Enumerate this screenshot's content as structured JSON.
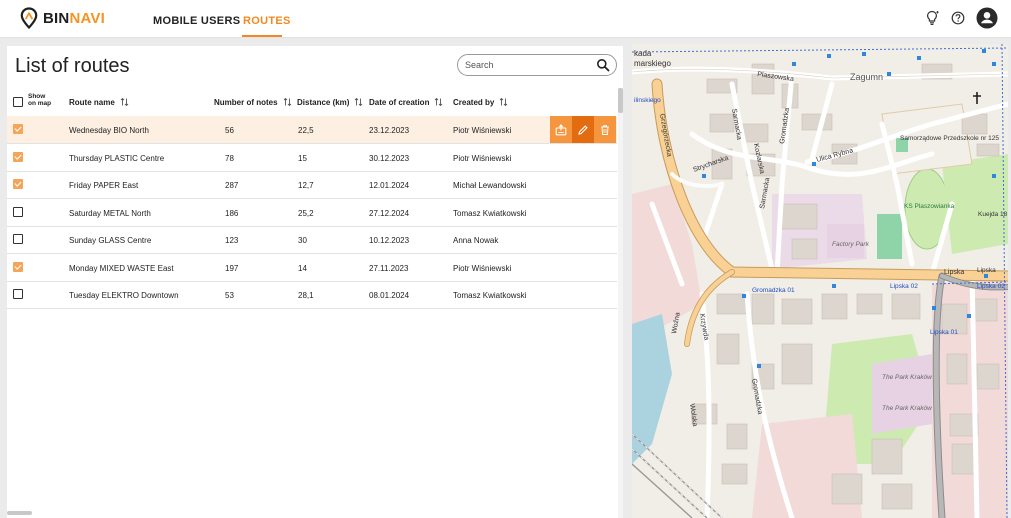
{
  "app": {
    "logo_part1": "BIN",
    "logo_part2": "NAVI"
  },
  "nav": {
    "tab_mobile_users": "MOBILE USERS",
    "tab_routes": "ROUTES",
    "active": "ROUTES"
  },
  "header_icons": [
    "lightbulb-icon",
    "help-icon",
    "account-icon"
  ],
  "page": {
    "title": "List of routes"
  },
  "search": {
    "placeholder": "Search",
    "value": ""
  },
  "table": {
    "show_on_map_line1": "Show",
    "show_on_map_line2": "on map",
    "columns": {
      "route_name": "Route name",
      "number_of_notes": "Number of notes",
      "distance": "Distance (km)",
      "date_of_creation": "Date of creation",
      "created_by": "Created by"
    },
    "rows": [
      {
        "checked": true,
        "name": "Wednesday BIO North",
        "notes": "56",
        "distance": "22,5",
        "date": "23.12.2023",
        "created_by": "Piotr Wiśniewski"
      },
      {
        "checked": true,
        "name": "Thursday PLASTIC Centre",
        "notes": "78",
        "distance": "15",
        "date": "30.12.2023",
        "created_by": "Piotr Wiśniewski"
      },
      {
        "checked": true,
        "name": "Friday PAPER East",
        "notes": "287",
        "distance": "12,7",
        "date": "12.01.2024",
        "created_by": "Michał Lewandowski"
      },
      {
        "checked": false,
        "name": "Saturday METAL North",
        "notes": "186",
        "distance": "25,2",
        "date": "27.12.2024",
        "created_by": "Tomasz Kwiatkowski"
      },
      {
        "checked": false,
        "name": "Sunday GLASS Centre",
        "notes": "123",
        "distance": "30",
        "date": "10.12.2023",
        "created_by": "Anna Nowak"
      },
      {
        "checked": true,
        "name": "Monday MIXED WASTE East",
        "notes": "197",
        "distance": "14",
        "date": "27.11.2023",
        "created_by": "Piotr Wiśniewski"
      },
      {
        "checked": false,
        "name": "Tuesday ELEKTRO Downtown",
        "notes": "53",
        "distance": "28,1",
        "date": "08.01.2024",
        "created_by": "Tomasz Kwiatkowski"
      }
    ],
    "row_actions": [
      "map-export-icon",
      "edit-icon",
      "delete-icon"
    ]
  },
  "map": {
    "labels": {
      "l1": "kada",
      "l2": "marskiego",
      "l3": "Plaszowska",
      "l4": "Zagumn",
      "l5": "ilinskiego",
      "l6": "Sarmacka",
      "l7": "Grzegórzecka",
      "l8": "Kozlarska",
      "l9": "Strycharska",
      "l10": "Gromadzka",
      "l11": "Sarmacka",
      "l12": "Ulica Rybna",
      "l13": "Samorządowe Przedszkole nr 125",
      "l14": "KS Plaszowianka",
      "l15": "Kuejda 18",
      "l16": "Factory Park",
      "l17": "Lipska",
      "l18": "Gromadzka 01",
      "l19": "Lipska 02",
      "l20": "Lipska 02",
      "l21": "Lipska",
      "l22": "Woźna",
      "l23": "Krzywda",
      "l24": "Wolska",
      "l25": "Gromadzka",
      "l26": "The Park Kraków",
      "l27": "The Park Kraków",
      "l28": "Lipska 01"
    },
    "colors": {
      "land": "#f1ede7",
      "building": "#ddd6ce",
      "green": "#cdebb0",
      "industrial": "#ebdbe8",
      "commercial": "#f2dad9",
      "road_major": "#f9d195",
      "road_minor": "#ffffff",
      "water": "#aad3df",
      "rail": "#999999"
    }
  },
  "colors": {
    "accent": "#f3891e",
    "accent_light": "#f5953d",
    "accent_dark": "#e26c0f",
    "selected_row": "#fdf0e3",
    "checkbox": "#f3a65a"
  }
}
